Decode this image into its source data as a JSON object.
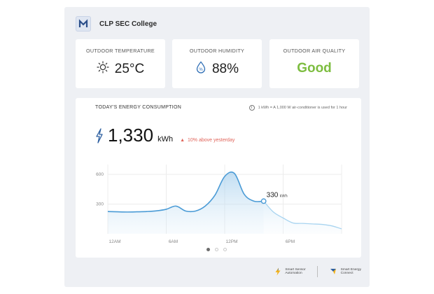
{
  "app": {
    "title": "CLP SEC College"
  },
  "stats": [
    {
      "label": "OUTDOOR TEMPERATURE",
      "value": "25°C",
      "icon": "sun-icon"
    },
    {
      "label": "OUTDOOR HUMIDITY",
      "value": "88%",
      "icon": "humidity-drop-icon"
    },
    {
      "label": "OUTDOOR AIR QUALITY",
      "value": "Good",
      "icon": "",
      "color": "#7dbd40"
    }
  ],
  "energy": {
    "title": "TODAY'S ENERGY CONSUMPTION",
    "note": "1 kWh = A 1,000 W air-conditioner is used for 1 hour",
    "value": "1,330",
    "unit": "kWh",
    "trend": "10% above yesterday",
    "trend_color": "#e0645a"
  },
  "chart_data": {
    "type": "area",
    "title": "",
    "xlabel": "",
    "ylabel": "",
    "x_ticks": [
      "12AM",
      "6AM",
      "12PM",
      "6PM"
    ],
    "y_ticks": [
      300,
      600
    ],
    "ylim": [
      0,
      700
    ],
    "xlim_hours": [
      0,
      24
    ],
    "series": [
      {
        "points_hours": [
          0,
          1,
          2,
          3,
          4,
          5,
          6,
          7,
          8,
          9,
          10,
          11,
          12,
          13,
          14,
          15,
          16
        ],
        "values": [
          225,
          222,
          220,
          222,
          225,
          232,
          248,
          280,
          230,
          230,
          280,
          390,
          580,
          610,
          400,
          330,
          330
        ],
        "color": "#4a9bd6"
      },
      {
        "points_hours": [
          16,
          17,
          18,
          19,
          20,
          21,
          22,
          23,
          24
        ],
        "values": [
          330,
          220,
          160,
          110,
          105,
          100,
          95,
          80,
          50
        ],
        "color": "#a8d4f0",
        "note": "forecast"
      }
    ],
    "highlight": {
      "value": "330",
      "unit": "kWh",
      "x_hour": 16
    },
    "grid": true
  },
  "pager": {
    "count": 3,
    "active": 0
  },
  "footer": {
    "brand1": [
      "Smart Sensor",
      "Automation"
    ],
    "brand2": [
      "Smart Energy",
      "Connect"
    ]
  }
}
